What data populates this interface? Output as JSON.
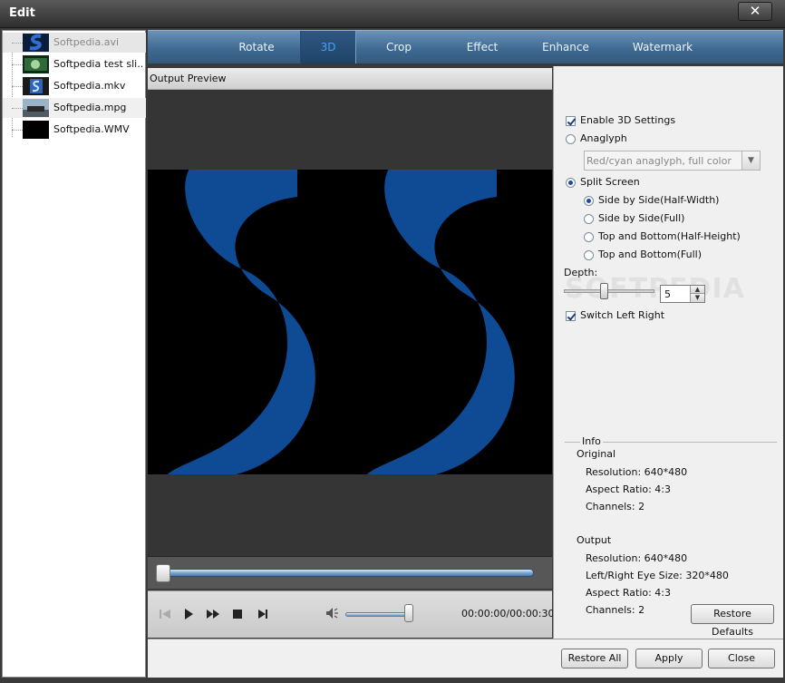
{
  "window": {
    "title": "Edit",
    "close_glyph": "✕"
  },
  "files": [
    {
      "name": "Softpedia.avi"
    },
    {
      "name": "Softpedia test sli..."
    },
    {
      "name": "Softpedia.mkv"
    },
    {
      "name": "Softpedia.mpg"
    },
    {
      "name": "Softpedia.WMV"
    }
  ],
  "tabs": [
    "Rotate",
    "3D",
    "Crop",
    "Effect",
    "Enhance",
    "Watermark"
  ],
  "preview": {
    "title": "Output Preview",
    "time": "00:00:00/00:00:30",
    "volume_level": 0.95,
    "seek_position": 0.0
  },
  "settings": {
    "enable_3d": "Enable 3D Settings",
    "anaglyph": "Anaglyph",
    "anaglyph_select": "Red/cyan anaglyph, full color",
    "split_screen": "Split Screen",
    "options": [
      "Side by Side(Half-Width)",
      "Side by Side(Full)",
      "Top and Bottom(Half-Height)",
      "Top and Bottom(Full)"
    ],
    "depth_label": "Depth:",
    "depth_value": "5",
    "switch_left_right": "Switch Left Right",
    "watermark_text": "SOFTPEDIA"
  },
  "info": {
    "legend": "Info",
    "original_title": "Original",
    "original": [
      "Resolution: 640*480",
      "Aspect Ratio: 4:3",
      "Channels: 2"
    ],
    "output_title": "Output",
    "output": [
      "Resolution: 640*480",
      "Left/Right Eye Size: 320*480",
      "Aspect Ratio: 4:3",
      "Channels: 2"
    ]
  },
  "buttons": {
    "restore_defaults": "Restore Defaults",
    "restore_all": "Restore All",
    "apply": "Apply",
    "close": "Close"
  },
  "colors": {
    "accent": "#3aa7ff",
    "tab_bar": "#3f6a93",
    "logo_blue": "#0f4a94"
  }
}
